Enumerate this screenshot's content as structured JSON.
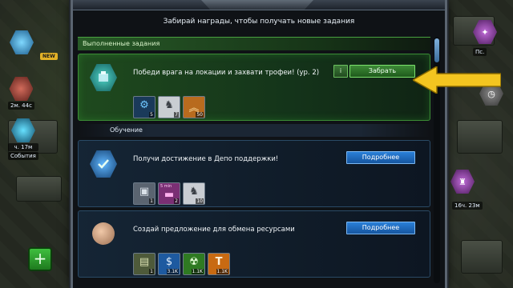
{
  "hud_left": {
    "stat1": "2м. 44с",
    "stat2": "ч. 17м",
    "events_label": "События",
    "new_badge": "NEW"
  },
  "hud_right": {
    "label1": "Пс.",
    "timer": "16ч. 23м"
  },
  "panel": {
    "header": "Забирай награды, чтобы получать новые задания",
    "sections": {
      "completed": "Выполненные задания",
      "training": "Обучение"
    },
    "tasks": [
      {
        "title": "Победи врага на локации и захвати трофеи! (ур. 2)",
        "info_label": "i",
        "action_label": "Забрать",
        "icon": "mech-hex-icon",
        "rewards": [
          {
            "icon": "gear-icon",
            "count": "5"
          },
          {
            "icon": "robot-icon",
            "count": "7"
          },
          {
            "icon": "rank-chevrons-icon",
            "count": "50"
          }
        ]
      },
      {
        "title": "Получи достижение в Депо поддержки!",
        "action_label": "Подробнее",
        "icon": "checkmark-shield-icon",
        "rewards": [
          {
            "icon": "crate-icon",
            "count": "1"
          },
          {
            "icon": "video-box-icon",
            "count": "2",
            "badge": "5 min"
          },
          {
            "icon": "robot-icon",
            "count": "10"
          }
        ]
      },
      {
        "title": "Создай предложение для обмена ресурсами",
        "action_label": "Подробнее",
        "icon": "commander-portrait-icon",
        "rewards": [
          {
            "icon": "ammo-crate-icon",
            "count": "1"
          },
          {
            "icon": "dollar-coin-icon",
            "count": "3.1K"
          },
          {
            "icon": "radiation-icon",
            "count": "1.1K"
          },
          {
            "icon": "titanium-icon",
            "count": "1.1K"
          }
        ]
      }
    ]
  },
  "colors": {
    "completed_green": "#3b8c35",
    "take_button": "#3d8a37",
    "more_button": "#2a7fd8",
    "arrow": "#f3c520"
  }
}
